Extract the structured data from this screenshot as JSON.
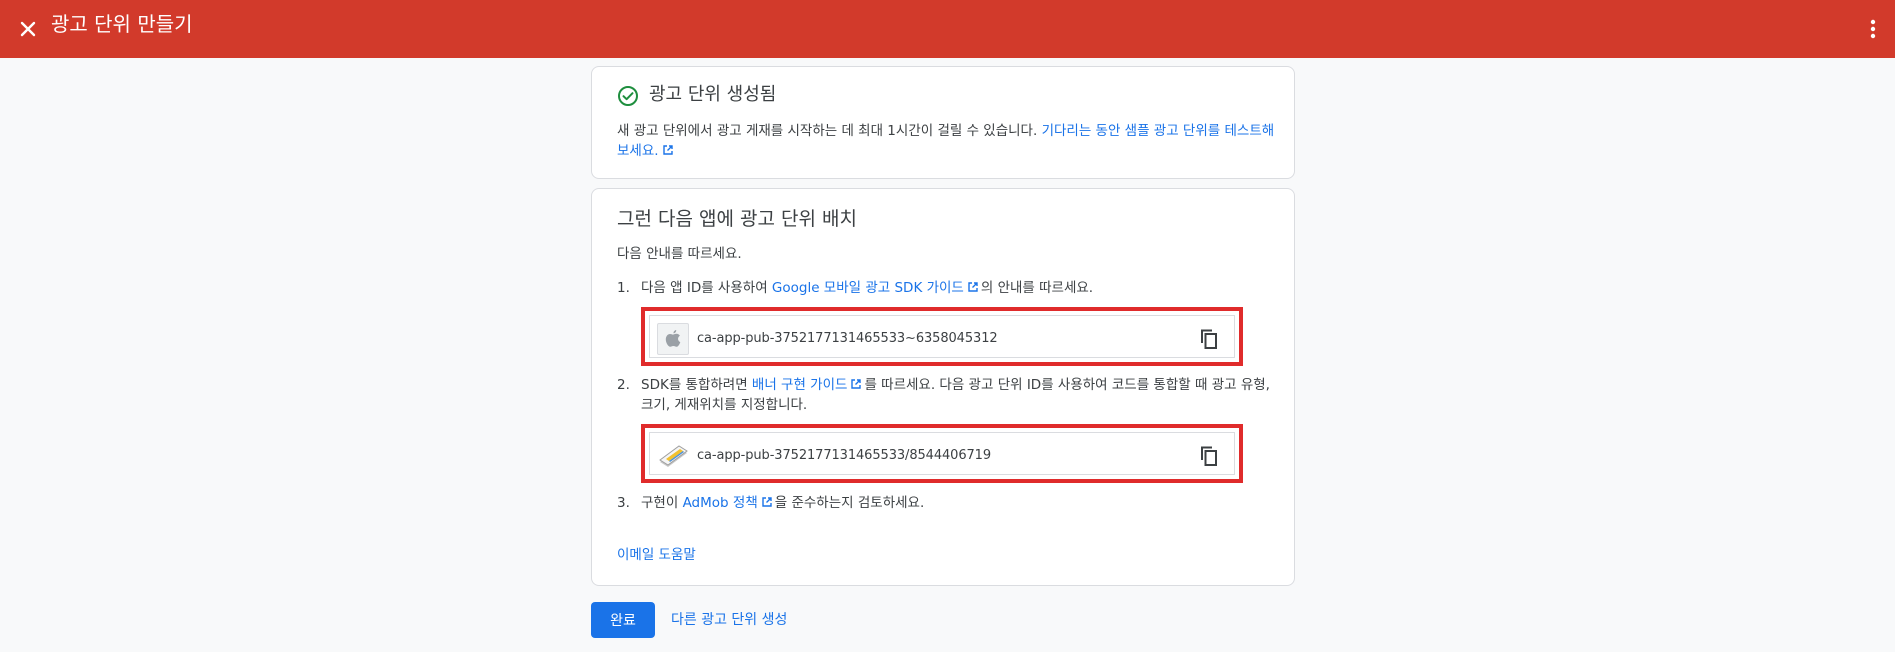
{
  "header": {
    "title": "광고 단위 만들기",
    "close_icon": "close-icon",
    "menu_icon": "more-vert-icon",
    "background_color": "#d23a2b"
  },
  "created_card": {
    "heading": "광고 단위 생성됨",
    "body_text": "새 광고 단위에서 광고 게재를 시작하는 데 최대 1시간이 걸릴 수 있습니다. ",
    "link_text": "기다리는 동안 샘플 광고 단위를 테스트해 보세요.",
    "status_color": "#1e8e3e"
  },
  "placement_card": {
    "heading": "그런 다음 앱에 광고 단위 배치",
    "intro": "다음 안내를 따르세요.",
    "step1": {
      "num": "1.",
      "prefix": "다음 앱 ID를 사용하여 ",
      "link": "Google 모바일 광고 SDK 가이드",
      "suffix": "의 안내를 따르세요."
    },
    "app_id": {
      "platform_icon": "apple-icon",
      "value": "ca-app-pub-3752177131465533~6358045312"
    },
    "step2": {
      "num": "2.",
      "prefix": "SDK를 통합하려면 ",
      "link": "배너 구현 가이드",
      "suffix": "를 따르세요. 다음 광고 단위 ID를 사용하여 코드를 통합할 때 광고 유형, 크기, 게재위치를 지정합니다."
    },
    "ad_unit_id": {
      "format_icon": "banner-icon",
      "value": "ca-app-pub-3752177131465533/8544406719"
    },
    "step3": {
      "num": "3.",
      "prefix": "구현이 ",
      "link": "AdMob 정책",
      "suffix": "을 준수하는지 검토하세요."
    },
    "email_help": "이메일 도움말"
  },
  "footer": {
    "done_label": "완료",
    "another_label": "다른 광고 단위 생성",
    "accent_color": "#1a73e8"
  }
}
